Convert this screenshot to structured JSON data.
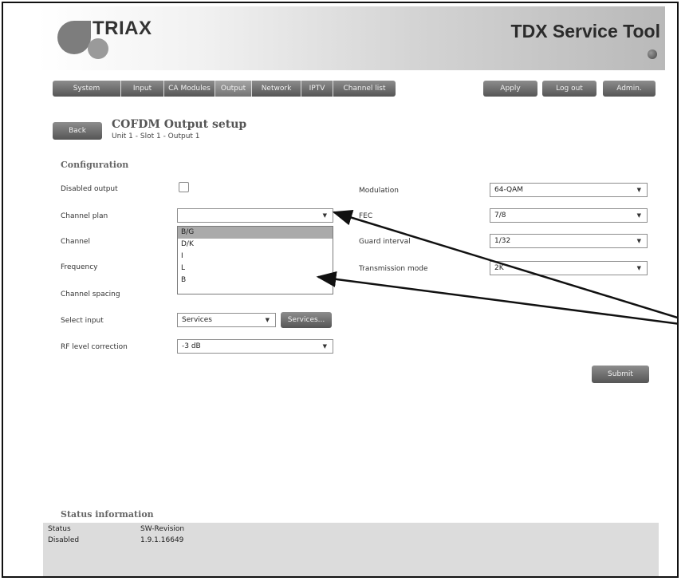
{
  "header": {
    "logo_text": "TRIAX",
    "app_title": "TDX Service Tool"
  },
  "nav": {
    "tabs": [
      "System",
      "Input",
      "CA Modules",
      "Output",
      "Network",
      "IPTV",
      "Channel list"
    ],
    "active": "Output",
    "actions": [
      "Apply",
      "Log out",
      "Admin."
    ]
  },
  "page": {
    "back_label": "Back",
    "title": "COFDM Output setup",
    "subtitle": "Unit 1 - Slot 1 - Output 1"
  },
  "config": {
    "section_title": "Configuration",
    "left": {
      "disabled_output_label": "Disabled output",
      "disabled_output_checked": false,
      "channel_plan_label": "Channel plan",
      "channel_plan_value": "",
      "channel_plan_options": [
        "B/G",
        "D/K",
        "I",
        "L",
        "B"
      ],
      "channel_plan_highlighted": "B/G",
      "channel_label": "Channel",
      "frequency_label": "Frequency",
      "channel_spacing_label": "Channel spacing",
      "select_input_label": "Select input",
      "select_input_value": "Services",
      "services_button_label": "Services...",
      "rf_level_label": "RF level correction",
      "rf_level_value": "-3 dB"
    },
    "right": {
      "modulation_label": "Modulation",
      "modulation_value": "64-QAM",
      "fec_label": "FEC",
      "fec_value": "7/8",
      "guard_interval_label": "Guard interval",
      "guard_interval_value": "1/32",
      "transmission_mode_label": "Transmission mode",
      "transmission_mode_value": "2K"
    },
    "submit_label": "Submit"
  },
  "status": {
    "section_title": "Status information",
    "headers": [
      "Status",
      "SW-Revision"
    ],
    "values": [
      "Disabled",
      "1.9.1.16649"
    ]
  },
  "colors": {
    "button_grey": "#6e6e6e",
    "panel_grey": "#dcdcdc",
    "highlight": "#aaaaaa"
  }
}
